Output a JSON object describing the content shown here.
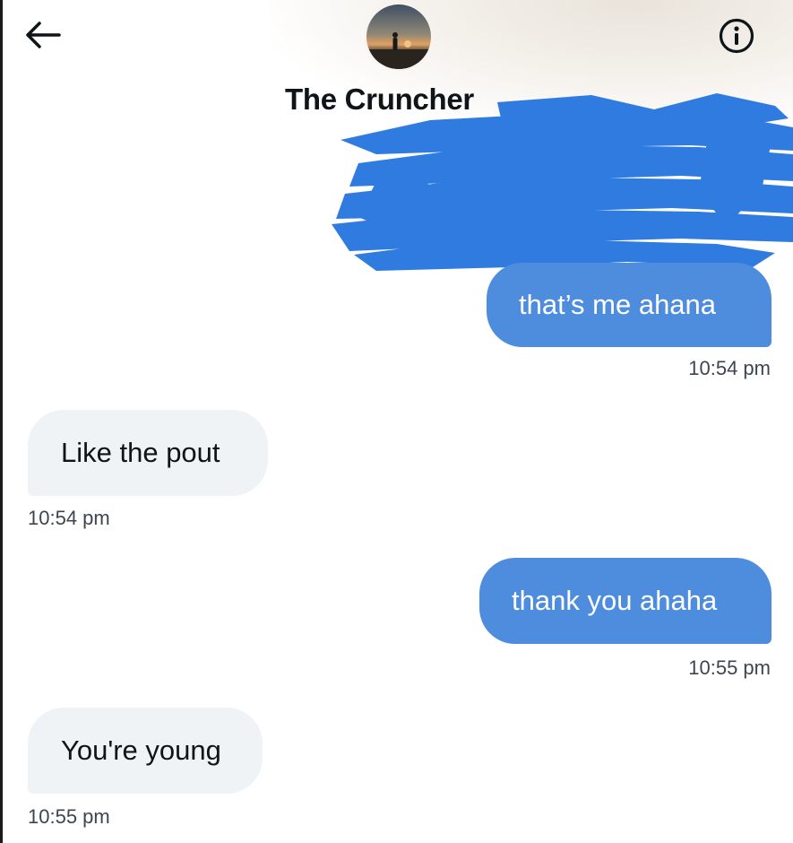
{
  "header": {
    "contact_name": "The Cruncher",
    "back_icon": "arrow-left-icon",
    "info_icon": "info-circle-icon",
    "avatar": "profile-photo-silhouette-sunset"
  },
  "redaction": {
    "color": "#2f7be0"
  },
  "messages": [
    {
      "direction": "outgoing",
      "text": "that’s me ahana",
      "time": "10:54 pm"
    },
    {
      "direction": "incoming",
      "text": "Like the pout",
      "time": "10:54 pm"
    },
    {
      "direction": "outgoing",
      "text": "thank you ahaha",
      "time": "10:55 pm"
    },
    {
      "direction": "incoming",
      "text": "You're young",
      "time": "10:55 pm"
    }
  ],
  "colors": {
    "outgoing_bubble": "#4e8ddd",
    "incoming_bubble": "#eff3f6",
    "text_primary": "#0f1419",
    "timestamp": "#3d4550"
  }
}
